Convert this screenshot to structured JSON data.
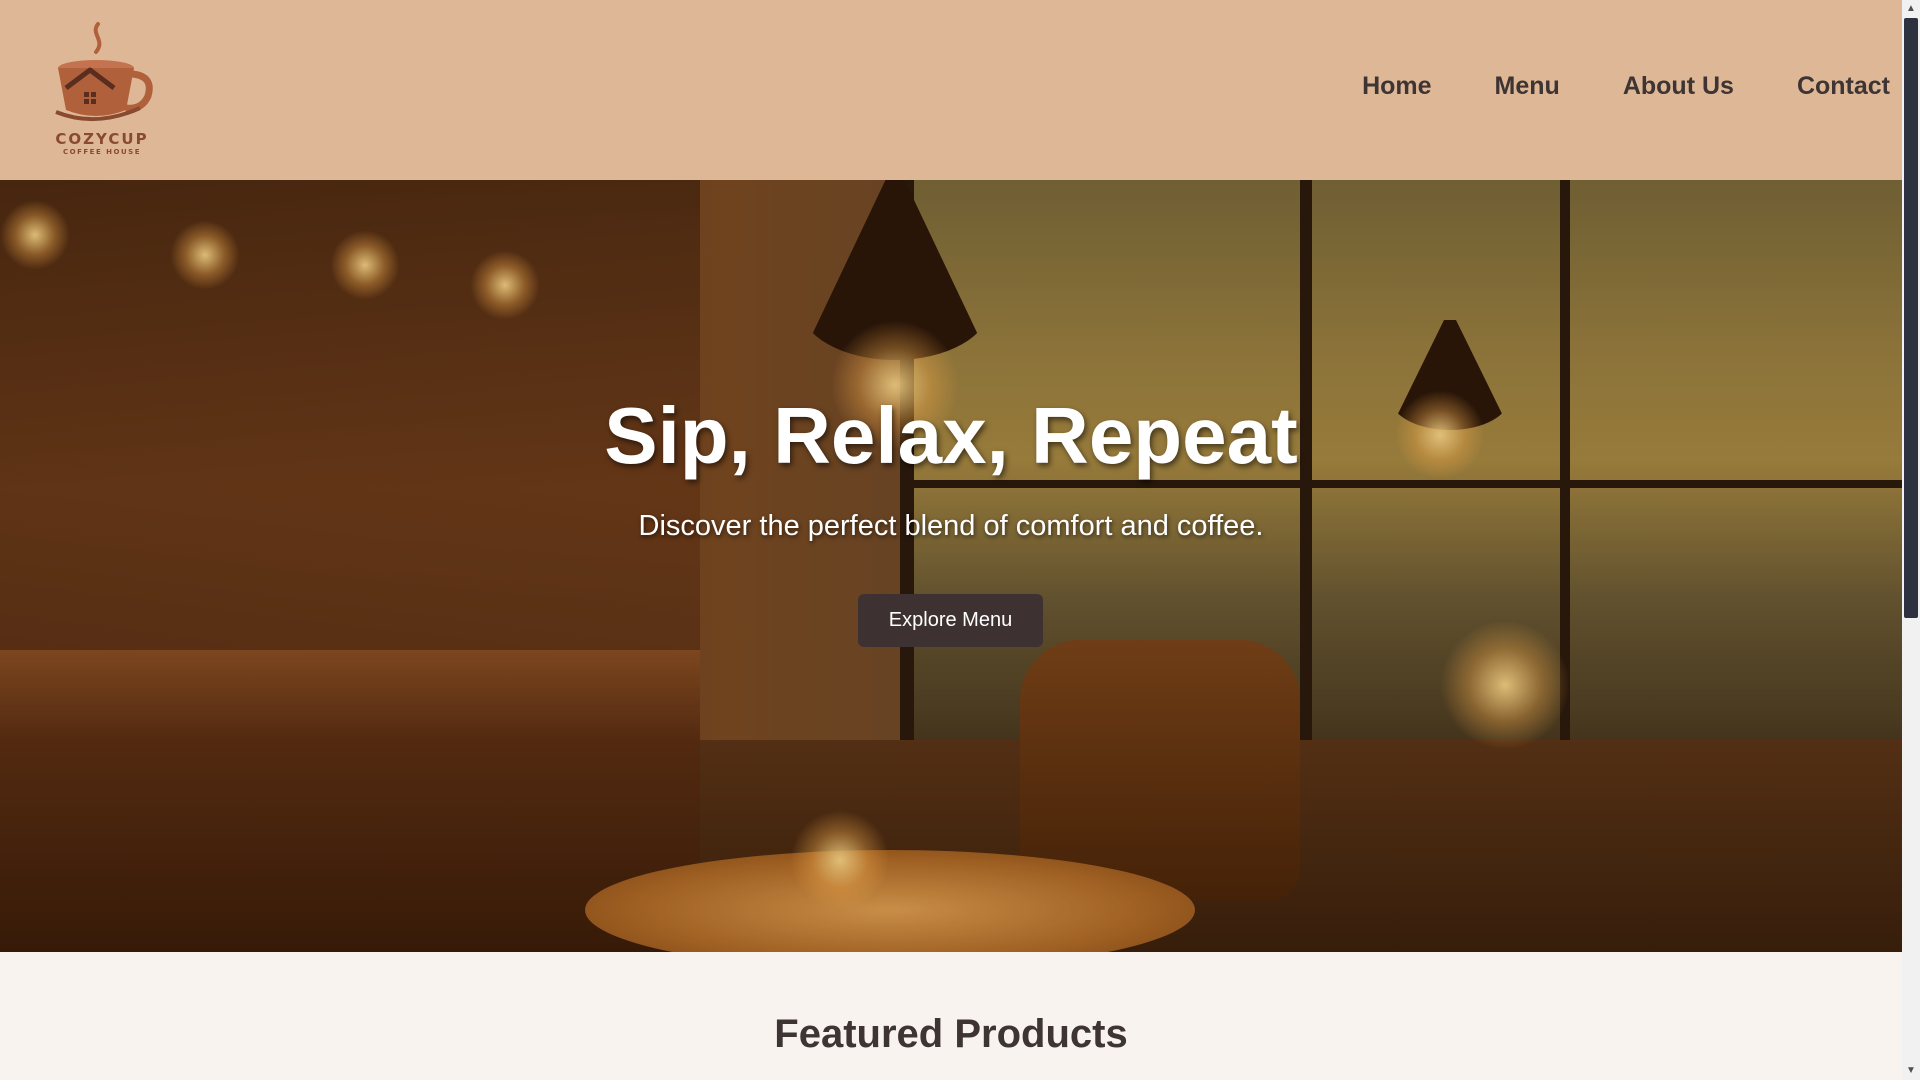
{
  "header": {
    "logo": {
      "name": "COZYCUP",
      "tagline": "COFFEE HOUSE"
    },
    "nav": [
      {
        "label": "Home"
      },
      {
        "label": "Menu"
      },
      {
        "label": "About Us"
      },
      {
        "label": "Contact"
      }
    ]
  },
  "hero": {
    "title": "Sip, Relax, Repeat",
    "subtitle": "Discover the perfect blend of comfort and coffee.",
    "button_label": "Explore Menu"
  },
  "featured": {
    "title": "Featured Products"
  },
  "colors": {
    "header_bg": "#deb896",
    "text_dark": "#3d3433",
    "button_bg": "#3d3231",
    "page_bg": "#f8f3ee",
    "logo_brown": "#8a4a2f"
  }
}
